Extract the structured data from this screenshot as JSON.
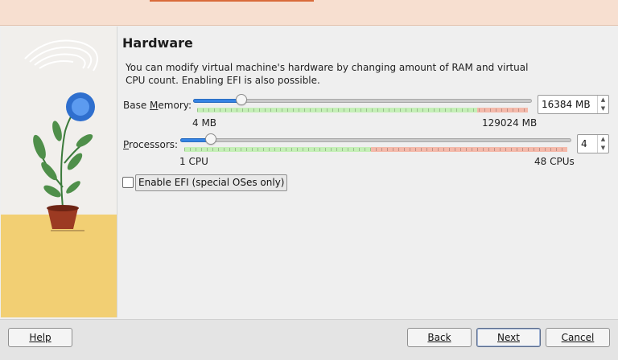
{
  "page": {
    "title": "Hardware",
    "description": "You can modify virtual machine's hardware by changing amount of RAM and virtual CPU count. Enabling EFI is also possible."
  },
  "memory": {
    "label_pre": "Base ",
    "label_mnemonic": "M",
    "label_post": "emory:",
    "value": "16384 MB",
    "min_label": "4 MB",
    "max_label": "129024 MB",
    "level_fraction": 0.127
  },
  "processors": {
    "label_mnemonic": "P",
    "label_post": "rocessors:",
    "value": "4",
    "min_label": "1 CPU",
    "max_label": "48 CPUs",
    "level_fraction": 0.0638
  },
  "efi": {
    "label": "Enable EFI (special OSes only)",
    "checked": false
  },
  "buttons": {
    "help": "Help",
    "back": "Back",
    "next": "Next",
    "cancel": "Cancel"
  },
  "colors": {
    "accent": "#3584e4",
    "safe_range": "#c4efb6",
    "warn_range": "#f4b9aa",
    "sidebar_sand": "#f2cf73"
  }
}
